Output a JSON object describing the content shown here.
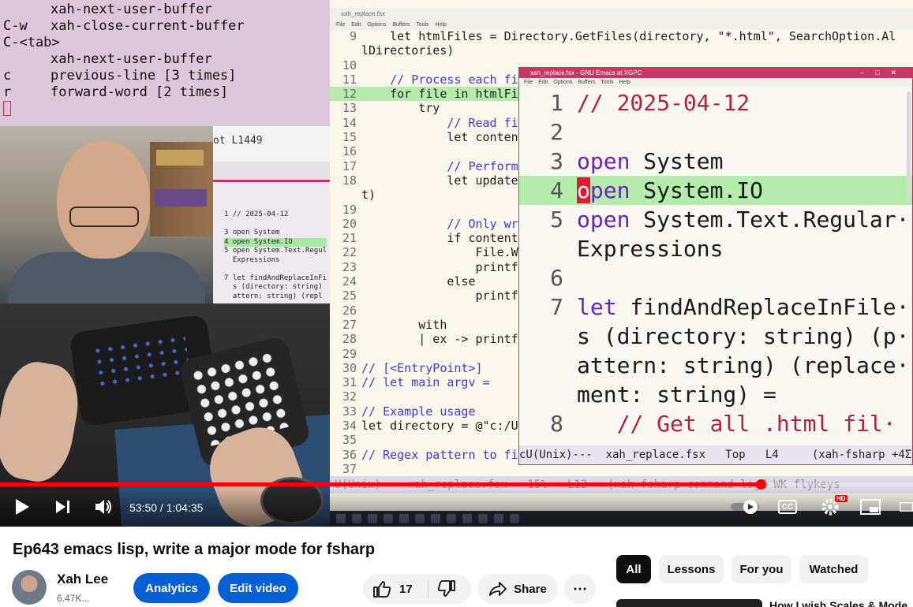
{
  "command_log": {
    "lines": [
      {
        "key": "",
        "cmd": "xah-next-user-buffer"
      },
      {
        "key": "C-w",
        "cmd": "xah-close-current-buffer"
      },
      {
        "key": "C-<tab>",
        "cmd": ""
      },
      {
        "key": "",
        "cmd": "xah-next-user-buffer"
      },
      {
        "key": "c",
        "cmd": "previous-line [3 times]"
      },
      {
        "key": "r",
        "cmd": "forward-word [2 times]"
      }
    ],
    "status_fragment": "ot   L1449"
  },
  "mini_screen": {
    "lines": [
      "1 // 2025-04-12",
      "",
      "3 open System",
      "4 open System.IO",
      "5 open System.Text.Regul",
      "  Expressions",
      "",
      "7 let findAndReplaceInFi",
      "  s (directory: string)",
      "  attern: string) (repl"
    ]
  },
  "back_editor": {
    "title": "xah_replace.fsx",
    "menu": [
      "File",
      "Edit",
      "Options",
      "Buffers",
      "Tools",
      "Help"
    ],
    "lines": [
      {
        "n": "9",
        "t": "    let htmlFiles = Directory.GetFiles(directory, \"*.html\", SearchOption.Al"
      },
      {
        "n": "",
        "t": "lDirectories)"
      },
      {
        "n": "10",
        "t": ""
      },
      {
        "n": "11",
        "t": "    // Process each file"
      },
      {
        "n": "12",
        "t": "    for file in htmlFile"
      },
      {
        "n": "13",
        "t": "        try"
      },
      {
        "n": "14",
        "t": "            // Read file"
      },
      {
        "n": "15",
        "t": "            let content"
      },
      {
        "n": "16",
        "t": ""
      },
      {
        "n": "17",
        "t": "            // Perform r"
      },
      {
        "n": "18",
        "t": "            let updatedC"
      },
      {
        "n": "",
        "t": "t)"
      },
      {
        "n": "19",
        "t": ""
      },
      {
        "n": "20",
        "t": "            // Only writ"
      },
      {
        "n": "21",
        "t": "            if content <"
      },
      {
        "n": "22",
        "t": "                File.Wri"
      },
      {
        "n": "23",
        "t": "                printfn"
      },
      {
        "n": "24",
        "t": "            else"
      },
      {
        "n": "25",
        "t": "                printfn"
      },
      {
        "n": "26",
        "t": ""
      },
      {
        "n": "27",
        "t": "        with"
      },
      {
        "n": "28",
        "t": "        | ex -> printfn"
      },
      {
        "n": "29",
        "t": ""
      },
      {
        "n": "30",
        "t": "// [<EntryPoint>]"
      },
      {
        "n": "31",
        "t": "// let main argv ="
      },
      {
        "n": "32",
        "t": ""
      },
      {
        "n": "33",
        "t": "// Example usage"
      },
      {
        "n": "34",
        "t": "let directory = @\"c:/Use"
      },
      {
        "n": "35",
        "t": ""
      },
      {
        "n": "36",
        "t": "// Regex pattern to find"
      },
      {
        "n": "37",
        "t": ""
      }
    ],
    "modeline": "U(Unix)    xah_replace.fsx   15%   L12   (xah-fsharp command-logΣ WK flykeys"
  },
  "front_editor": {
    "title": "xah_replace.fsx - GNU Emacs at XGPC",
    "menu": [
      "File",
      "Edit",
      "Options",
      "Buffers",
      "Tools",
      "Help"
    ],
    "lines": [
      {
        "n": "1",
        "kind": "comment",
        "t": "// 2025-04-12"
      },
      {
        "n": "2",
        "kind": "plain",
        "t": ""
      },
      {
        "n": "3",
        "kind": "open",
        "kw": "open",
        "t": " System"
      },
      {
        "n": "4",
        "kind": "cursor",
        "cur": "o",
        "kw": "pen",
        "t": " System.IO"
      },
      {
        "n": "5",
        "kind": "open",
        "kw": "open",
        "t": " System.Text.Regular·"
      },
      {
        "n": "",
        "kind": "plain",
        "t": "Expressions"
      },
      {
        "n": "6",
        "kind": "plain",
        "t": ""
      },
      {
        "n": "7",
        "kind": "open",
        "kw": "let",
        "t": " findAndReplaceInFile·"
      },
      {
        "n": "",
        "kind": "plain",
        "t": "s (directory: string) (p·"
      },
      {
        "n": "",
        "kind": "plain",
        "t": "attern: string) (replace·"
      },
      {
        "n": "",
        "kind": "plain",
        "t": "ment: string) ="
      },
      {
        "n": "8",
        "kind": "comment",
        "t": "   // Get all .html fil·"
      }
    ],
    "modeline": "cU(Unix)---  xah_replace.fsx   Top   L4     (xah-fsharp +4Σc"
  },
  "player": {
    "current_time": "53:50",
    "separator": " / ",
    "total_time": "1:04:35",
    "progress": 0.8335,
    "hd_badge": "HD",
    "cc_label": "CC"
  },
  "video": {
    "title": "Ep643 emacs lisp, write a major mode for fsharp",
    "channel": "Xah Lee",
    "subscribers": "6.47K...",
    "analytics_label": "Analytics",
    "edit_label": "Edit video",
    "likes": "17",
    "share_label": "Share",
    "more_label": "⋯"
  },
  "chips": [
    "All",
    "Lessons",
    "For you",
    "Watched"
  ],
  "recommendation": {
    "title_fragment": "How I wish Scales & Mode"
  }
}
